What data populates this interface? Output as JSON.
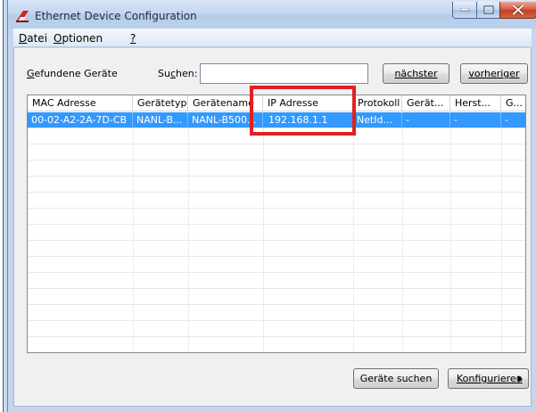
{
  "window": {
    "title": "Ethernet Device Configuration",
    "accent_color": "#3399ff",
    "highlight_color": "#e02121"
  },
  "menu": {
    "items": [
      {
        "key": "D",
        "rest": "atei"
      },
      {
        "key": "O",
        "rest": "ptionen"
      },
      {
        "key": "?",
        "rest": ""
      }
    ]
  },
  "search": {
    "found_label_key": "G",
    "found_label_rest": "efundene Geräte",
    "search_label_pre": "Su",
    "search_label_key": "c",
    "search_label_post": "hen:",
    "value": "",
    "next_button": "nächster",
    "prev_button": "vorheriger"
  },
  "devices": {
    "columns": [
      "MAC Adresse",
      "Gerätetyp",
      "Gerätename",
      "IP Adresse",
      "Protokoll",
      "Gerät...",
      "Herst...",
      "G..."
    ],
    "rows": [
      [
        "00-02-A2-2A-7D-CB",
        "NANL-B...",
        "NANL-B500...",
        "192.168.1.1",
        "NetId...",
        "-",
        "-",
        "-"
      ]
    ]
  },
  "footer": {
    "search_devices_button": "Geräte suchen",
    "configure_button": "Konfigurieren"
  },
  "icons": {
    "app": "app-icon",
    "minimize": "minimize-icon",
    "maximize": "maximize-icon",
    "close": "close-icon",
    "arrow": "triangle-right-icon"
  }
}
